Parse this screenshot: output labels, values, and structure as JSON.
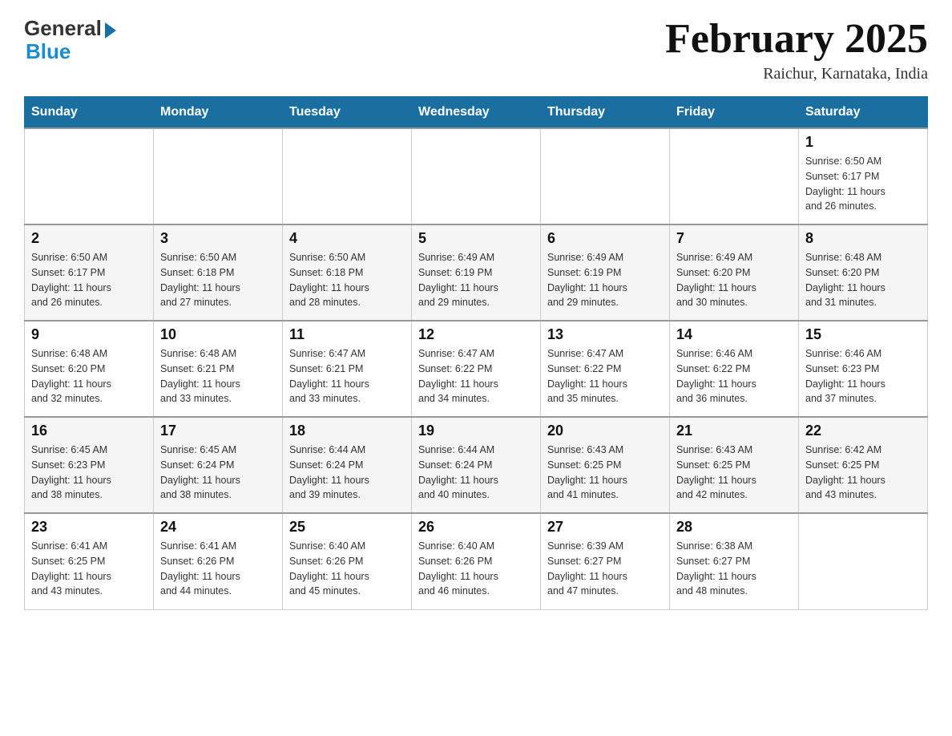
{
  "header": {
    "logo_general": "General",
    "logo_blue": "Blue",
    "month_title": "February 2025",
    "location": "Raichur, Karnataka, India"
  },
  "days_of_week": [
    "Sunday",
    "Monday",
    "Tuesday",
    "Wednesday",
    "Thursday",
    "Friday",
    "Saturday"
  ],
  "weeks": [
    [
      {
        "day": "",
        "info": ""
      },
      {
        "day": "",
        "info": ""
      },
      {
        "day": "",
        "info": ""
      },
      {
        "day": "",
        "info": ""
      },
      {
        "day": "",
        "info": ""
      },
      {
        "day": "",
        "info": ""
      },
      {
        "day": "1",
        "info": "Sunrise: 6:50 AM\nSunset: 6:17 PM\nDaylight: 11 hours\nand 26 minutes."
      }
    ],
    [
      {
        "day": "2",
        "info": "Sunrise: 6:50 AM\nSunset: 6:17 PM\nDaylight: 11 hours\nand 26 minutes."
      },
      {
        "day": "3",
        "info": "Sunrise: 6:50 AM\nSunset: 6:18 PM\nDaylight: 11 hours\nand 27 minutes."
      },
      {
        "day": "4",
        "info": "Sunrise: 6:50 AM\nSunset: 6:18 PM\nDaylight: 11 hours\nand 28 minutes."
      },
      {
        "day": "5",
        "info": "Sunrise: 6:49 AM\nSunset: 6:19 PM\nDaylight: 11 hours\nand 29 minutes."
      },
      {
        "day": "6",
        "info": "Sunrise: 6:49 AM\nSunset: 6:19 PM\nDaylight: 11 hours\nand 29 minutes."
      },
      {
        "day": "7",
        "info": "Sunrise: 6:49 AM\nSunset: 6:20 PM\nDaylight: 11 hours\nand 30 minutes."
      },
      {
        "day": "8",
        "info": "Sunrise: 6:48 AM\nSunset: 6:20 PM\nDaylight: 11 hours\nand 31 minutes."
      }
    ],
    [
      {
        "day": "9",
        "info": "Sunrise: 6:48 AM\nSunset: 6:20 PM\nDaylight: 11 hours\nand 32 minutes."
      },
      {
        "day": "10",
        "info": "Sunrise: 6:48 AM\nSunset: 6:21 PM\nDaylight: 11 hours\nand 33 minutes."
      },
      {
        "day": "11",
        "info": "Sunrise: 6:47 AM\nSunset: 6:21 PM\nDaylight: 11 hours\nand 33 minutes."
      },
      {
        "day": "12",
        "info": "Sunrise: 6:47 AM\nSunset: 6:22 PM\nDaylight: 11 hours\nand 34 minutes."
      },
      {
        "day": "13",
        "info": "Sunrise: 6:47 AM\nSunset: 6:22 PM\nDaylight: 11 hours\nand 35 minutes."
      },
      {
        "day": "14",
        "info": "Sunrise: 6:46 AM\nSunset: 6:22 PM\nDaylight: 11 hours\nand 36 minutes."
      },
      {
        "day": "15",
        "info": "Sunrise: 6:46 AM\nSunset: 6:23 PM\nDaylight: 11 hours\nand 37 minutes."
      }
    ],
    [
      {
        "day": "16",
        "info": "Sunrise: 6:45 AM\nSunset: 6:23 PM\nDaylight: 11 hours\nand 38 minutes."
      },
      {
        "day": "17",
        "info": "Sunrise: 6:45 AM\nSunset: 6:24 PM\nDaylight: 11 hours\nand 38 minutes."
      },
      {
        "day": "18",
        "info": "Sunrise: 6:44 AM\nSunset: 6:24 PM\nDaylight: 11 hours\nand 39 minutes."
      },
      {
        "day": "19",
        "info": "Sunrise: 6:44 AM\nSunset: 6:24 PM\nDaylight: 11 hours\nand 40 minutes."
      },
      {
        "day": "20",
        "info": "Sunrise: 6:43 AM\nSunset: 6:25 PM\nDaylight: 11 hours\nand 41 minutes."
      },
      {
        "day": "21",
        "info": "Sunrise: 6:43 AM\nSunset: 6:25 PM\nDaylight: 11 hours\nand 42 minutes."
      },
      {
        "day": "22",
        "info": "Sunrise: 6:42 AM\nSunset: 6:25 PM\nDaylight: 11 hours\nand 43 minutes."
      }
    ],
    [
      {
        "day": "23",
        "info": "Sunrise: 6:41 AM\nSunset: 6:25 PM\nDaylight: 11 hours\nand 43 minutes."
      },
      {
        "day": "24",
        "info": "Sunrise: 6:41 AM\nSunset: 6:26 PM\nDaylight: 11 hours\nand 44 minutes."
      },
      {
        "day": "25",
        "info": "Sunrise: 6:40 AM\nSunset: 6:26 PM\nDaylight: 11 hours\nand 45 minutes."
      },
      {
        "day": "26",
        "info": "Sunrise: 6:40 AM\nSunset: 6:26 PM\nDaylight: 11 hours\nand 46 minutes."
      },
      {
        "day": "27",
        "info": "Sunrise: 6:39 AM\nSunset: 6:27 PM\nDaylight: 11 hours\nand 47 minutes."
      },
      {
        "day": "28",
        "info": "Sunrise: 6:38 AM\nSunset: 6:27 PM\nDaylight: 11 hours\nand 48 minutes."
      },
      {
        "day": "",
        "info": ""
      }
    ]
  ]
}
